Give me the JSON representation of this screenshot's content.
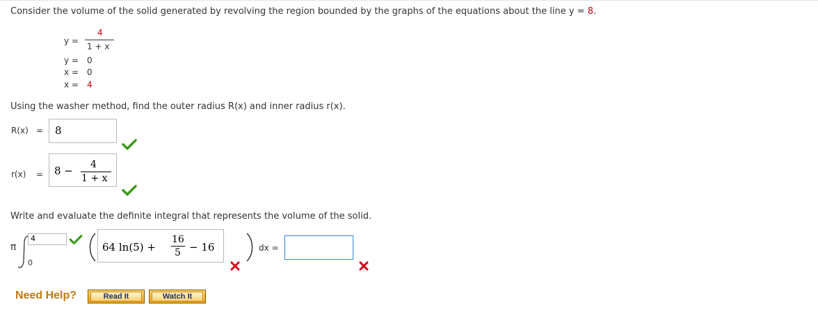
{
  "problem": {
    "intro_prefix": "Consider the volume of the solid generated by revolving the region bounded by the graphs of the equations about the line y = ",
    "intro_value": "8",
    "intro_suffix": "."
  },
  "equations": {
    "eq1": {
      "lhs": "y =",
      "numerator": "4",
      "denominator": "1 + x"
    },
    "eq2": {
      "lhs": "y =",
      "rhs": "0"
    },
    "eq3": {
      "lhs": "x =",
      "rhs": "0"
    },
    "eq4": {
      "lhs": "x =",
      "rhs": "4"
    }
  },
  "part1": {
    "instruction": "Using the washer method, find the outer radius R(x) and inner radius r(x).",
    "outer_label": "R(x)",
    "outer_eq": "=",
    "outer_value": "8",
    "inner_label": "r(x)",
    "inner_eq": "=",
    "inner_value_lead": "8 −",
    "inner_value_num": "4",
    "inner_value_den": "1 + x"
  },
  "part2": {
    "instruction": "Write and evaluate the definite integral that represents the volume of the solid.",
    "pi": "π",
    "lower_limit": "0",
    "upper_limit": "4",
    "integrand_lead": "64 ln(5) +",
    "integrand_num": "16",
    "integrand_den": "5",
    "integrand_tail": "− 16",
    "dx_label": "dx =",
    "result_value": ""
  },
  "status": {
    "correct_color": "#3a9a1a",
    "incorrect_color": "#d0021b"
  },
  "help": {
    "label": "Need Help?",
    "read_button": "Read It",
    "watch_button": "Watch It"
  }
}
